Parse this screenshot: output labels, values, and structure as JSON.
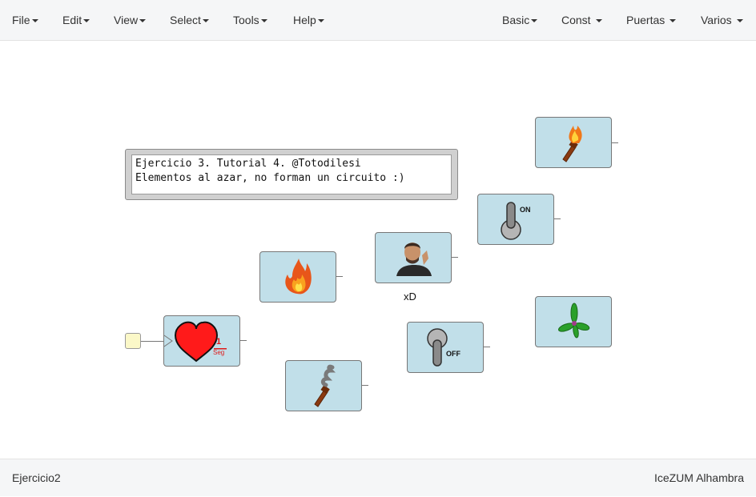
{
  "menubar": {
    "left": [
      {
        "label": "File"
      },
      {
        "label": "Edit"
      },
      {
        "label": "View"
      },
      {
        "label": "Select"
      },
      {
        "label": "Tools"
      },
      {
        "label": "Help"
      }
    ],
    "right": [
      {
        "label": "Basic"
      },
      {
        "label": "Const"
      },
      {
        "label": "Puertas"
      },
      {
        "label": "Varios"
      }
    ]
  },
  "canvas": {
    "comment": {
      "line1": "Ejercicio 3. Tutorial 4. @Totodilesi",
      "line2": "Elementos al azar, no forman un circuito :)"
    },
    "photo_block_label": "xD",
    "heart_block": {
      "numerator": "1",
      "denominator": "Seg"
    },
    "switch_on_label": "ON",
    "switch_off_label": "OFF",
    "blocks": [
      {
        "name": "torch-on-block",
        "icon": "torch-lit-icon"
      },
      {
        "name": "switch-on-block",
        "icon": "switch-on-icon"
      },
      {
        "name": "photo-block",
        "icon": "person-photo-icon"
      },
      {
        "name": "fire-block",
        "icon": "fire-icon"
      },
      {
        "name": "heartbeat-block",
        "icon": "heart-icon"
      },
      {
        "name": "torch-off-block",
        "icon": "torch-smoke-icon"
      },
      {
        "name": "switch-off-block",
        "icon": "switch-off-icon"
      },
      {
        "name": "propeller-block",
        "icon": "propeller-icon"
      }
    ],
    "colors": {
      "block_fill": "#c1dfe9",
      "block_border": "#777777",
      "input_pin": "#fbf8c8"
    }
  },
  "footer": {
    "project_name": "Ejercicio2",
    "app_name": "IceZUM Alhambra"
  }
}
